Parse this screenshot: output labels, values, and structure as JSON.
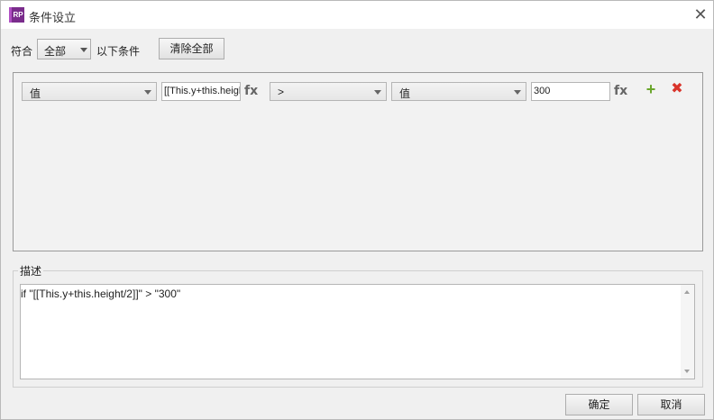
{
  "window": {
    "app_icon_text": "RP",
    "title": "条件设立"
  },
  "match_row": {
    "match_label": "符合",
    "match_value": "全部",
    "condition_label": "以下条件",
    "clear_button": "清除全部"
  },
  "condition": {
    "left_type": "值",
    "left_expr": "[[This.y+this.height/2]]",
    "fx1": "fx",
    "operator": ">",
    "right_type": "值",
    "right_value": "300",
    "fx2": "fx",
    "add_glyph": "+",
    "delete_glyph": "✖"
  },
  "description": {
    "legend": "描述",
    "text": "if \"[[This.y+this.height/2]]\" > \"300\""
  },
  "footer": {
    "ok_button": "确定",
    "cancel_button": "取消"
  },
  "colors": {
    "add": "#6aa62c",
    "delete": "#d9342b",
    "app_icon": "#7a2c8c"
  }
}
